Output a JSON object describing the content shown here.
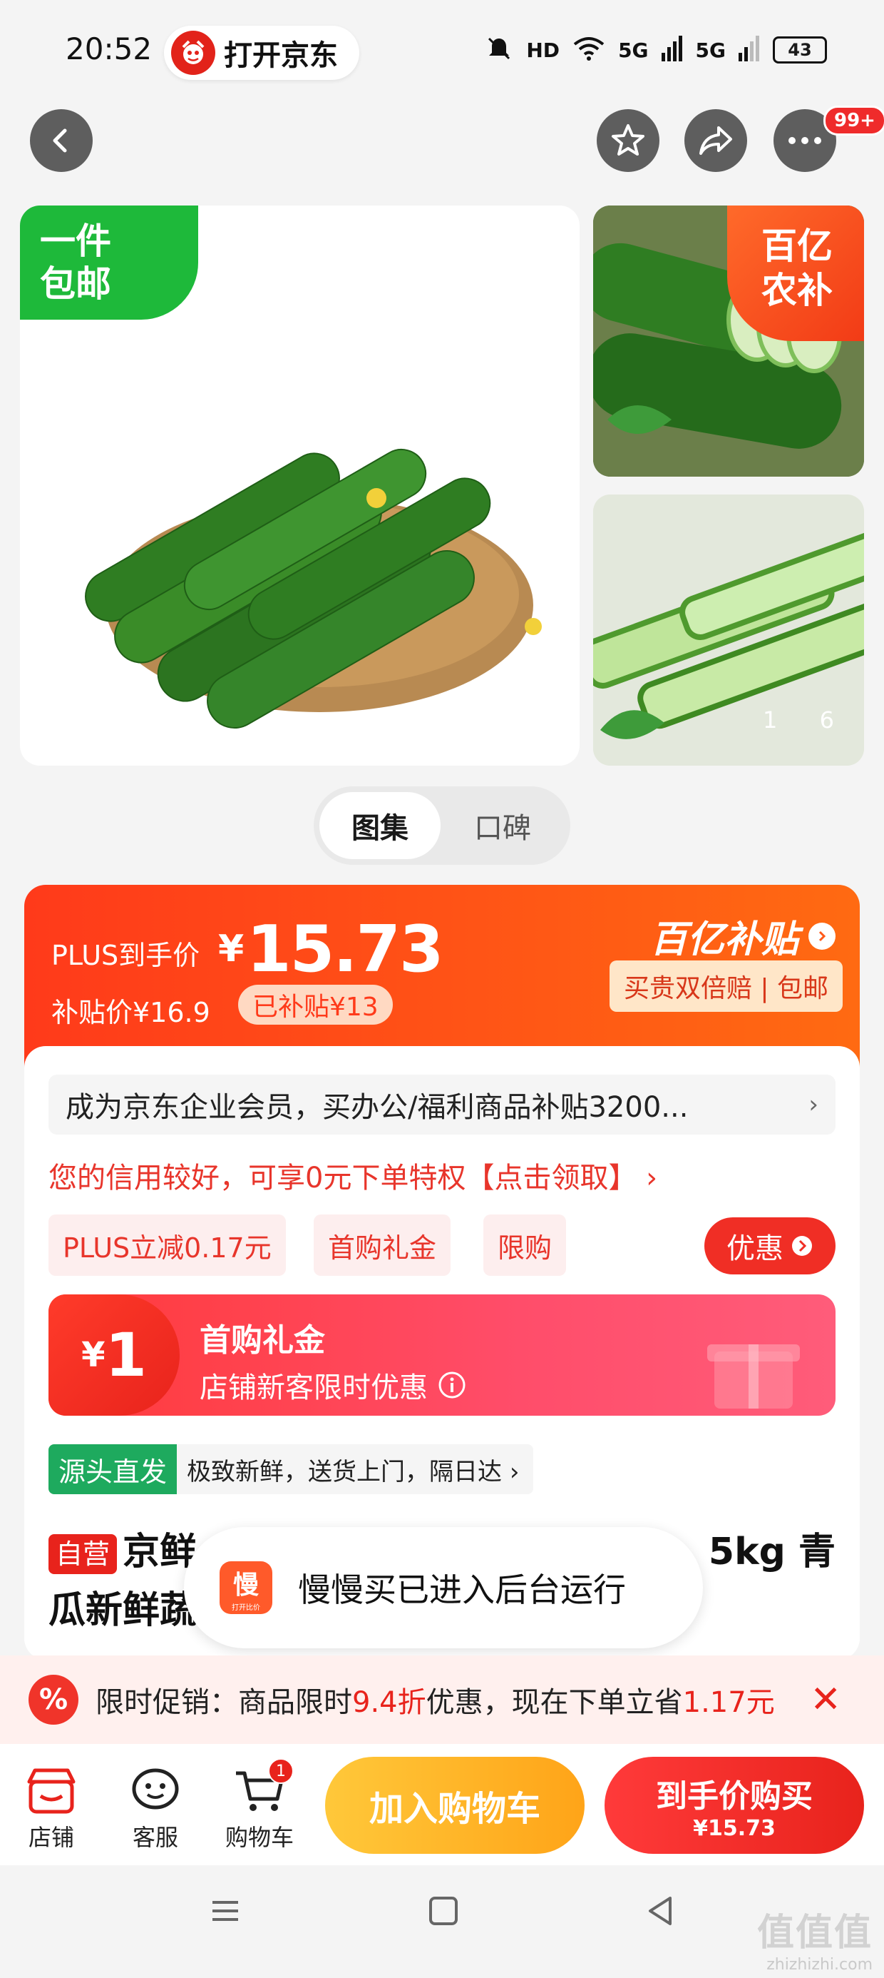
{
  "status_bar": {
    "time": "20:52",
    "open_app_label": "打开京东",
    "network_hd": "HD",
    "net1": "5G",
    "net2": "5G",
    "battery": "43"
  },
  "nav": {
    "more_badge": "99+"
  },
  "gallery": {
    "free_shipping_line1": "一件",
    "free_shipping_line2": "包邮",
    "bybt_line1": "百亿",
    "bybt_line2": "农补",
    "counter_current": "1",
    "counter_total": "6"
  },
  "tabs": [
    {
      "label": "图集"
    },
    {
      "label": "口碑"
    }
  ],
  "price": {
    "plus_label": "PLUS到手价",
    "yen": "¥",
    "amount": "15.73",
    "subsidy_price_label": "补贴价¥16.9",
    "subsidized_chip": "已补贴¥13",
    "bybt_title": "百亿补贴",
    "bybt_sub": "买贵双倍赔 | 包邮"
  },
  "info": {
    "enterprise_text": "成为京东企业会员，买办公/福利商品补贴3200...",
    "credit_text": "您的信用较好，可享0元下单特权【点击领取】 ›",
    "chips": [
      "PLUS立减0.17元",
      "首购礼金",
      "限购"
    ],
    "coupon_button": "优惠",
    "gift_amount_yen": "¥",
    "gift_amount": "1",
    "gift_title": "首购礼金",
    "gift_desc": "店铺新客限时优惠",
    "source_tag": "源头直发",
    "source_text": "极致新鲜，送货上门，隔日达 ›",
    "self_tag": "自营",
    "title_line1_left": "京鲜",
    "title_line1_right": "5kg 青",
    "title_line2": "瓜新鲜蔬"
  },
  "toast": {
    "icon_text": "慢",
    "icon_sub": "打开比价",
    "message": "慢慢买已进入后台运行"
  },
  "promo": {
    "prefix": "限时促销：商品限时",
    "discount": "9.4折",
    "middle": "优惠，现在下单立省",
    "saving": "1.17元"
  },
  "bottom_bar": {
    "store": "店铺",
    "service": "客服",
    "cart": "购物车",
    "cart_count": "1",
    "add_to_cart": "加入购物车",
    "buy_now": "到手价购买",
    "buy_price": "¥15.73"
  },
  "watermark": {
    "big": "值值值",
    "small": "zhizhizhi.com"
  }
}
